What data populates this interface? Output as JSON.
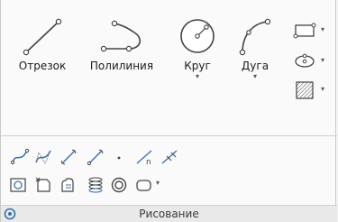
{
  "ribbon_panel": {
    "title": "Рисование",
    "large_buttons": [
      {
        "label": "Отрезок",
        "icon": "line-icon"
      },
      {
        "label": "Полилиния",
        "icon": "polyline-icon"
      },
      {
        "label": "Круг",
        "icon": "circle-icon",
        "has_dropdown": true
      },
      {
        "label": "Дуга",
        "icon": "arc-icon",
        "has_dropdown": true
      }
    ],
    "side_buttons": [
      {
        "icon": "rectangle-icon",
        "has_dropdown": true
      },
      {
        "icon": "ellipse-icon",
        "has_dropdown": true
      },
      {
        "icon": "hatch-icon",
        "has_dropdown": true
      }
    ],
    "tool_row_1": [
      "spline-fit-icon",
      "spline-cv-icon",
      "construction-line-icon",
      "ray-icon",
      "point-icon",
      "divide-icon",
      "measure-icon"
    ],
    "tool_row_2": [
      "region-icon",
      "wipeout-icon",
      "revision-cloud-icon",
      "helix-icon",
      "donut-icon",
      "boundary-icon"
    ],
    "dropdown_caret": "▾"
  }
}
